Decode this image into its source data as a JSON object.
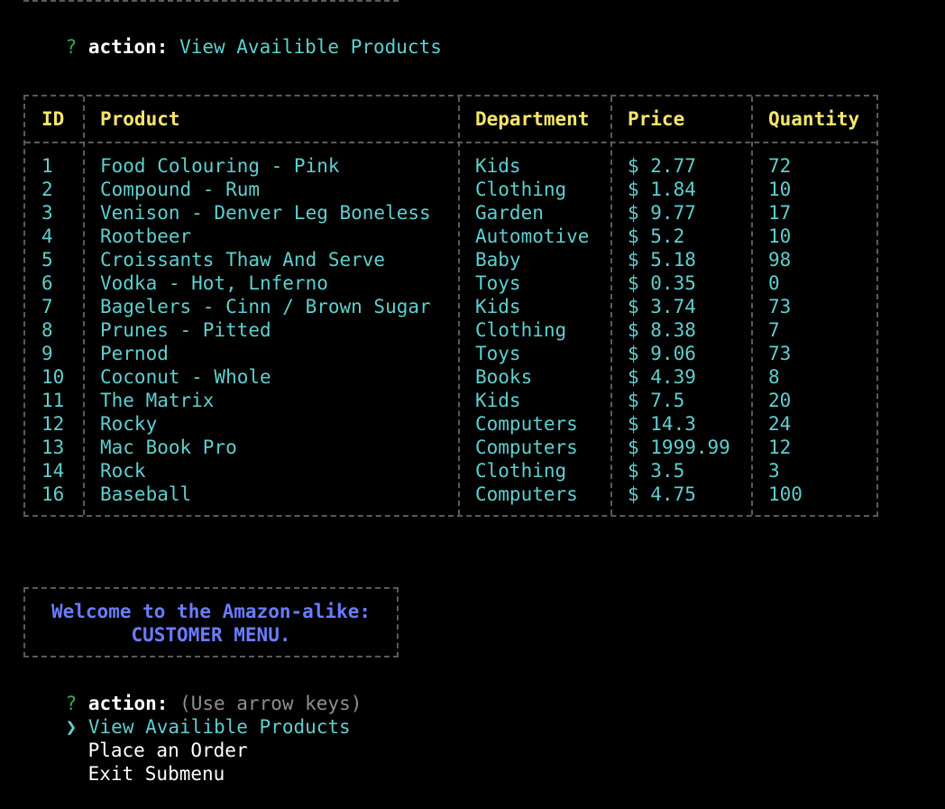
{
  "prompt_prefix": "?",
  "action_label": "action:",
  "previous_answer": "View Availible Products",
  "table": {
    "headers": [
      "ID",
      "Product",
      "Department",
      "Price",
      "Quantity"
    ],
    "rows": [
      [
        "1",
        "Food Colouring - Pink",
        "Kids",
        "$ 2.77",
        "72"
      ],
      [
        "2",
        "Compound - Rum",
        "Clothing",
        "$ 1.84",
        "10"
      ],
      [
        "3",
        "Venison - Denver Leg Boneless",
        "Garden",
        "$ 9.77",
        "17"
      ],
      [
        "4",
        "Rootbeer",
        "Automotive",
        "$ 5.2",
        "10"
      ],
      [
        "5",
        "Croissants Thaw And Serve",
        "Baby",
        "$ 5.18",
        "98"
      ],
      [
        "6",
        "Vodka - Hot, Lnferno",
        "Toys",
        "$ 0.35",
        "0"
      ],
      [
        "7",
        "Bagelers - Cinn / Brown Sugar",
        "Kids",
        "$ 3.74",
        "73"
      ],
      [
        "8",
        "Prunes - Pitted",
        "Clothing",
        "$ 8.38",
        "7"
      ],
      [
        "9",
        "Pernod",
        "Toys",
        "$ 9.06",
        "73"
      ],
      [
        "10",
        "Coconut - Whole",
        "Books",
        "$ 4.39",
        "8"
      ],
      [
        "11",
        "The Matrix",
        "Kids",
        "$ 7.5",
        "20"
      ],
      [
        "12",
        "Rocky",
        "Computers",
        "$ 14.3",
        "24"
      ],
      [
        "13",
        "Mac Book Pro",
        "Computers",
        "$ 1999.99",
        "12"
      ],
      [
        "14",
        "Rock",
        "Clothing",
        "$ 3.5",
        "3"
      ],
      [
        "16",
        "Baseball",
        "Computers",
        "$ 4.75",
        "100"
      ]
    ]
  },
  "menu_box": {
    "line1": "Welcome to the Amazon-alike:",
    "line2": "CUSTOMER MENU."
  },
  "current_prompt": {
    "hint": "(Use arrow keys)",
    "pointer": "❯",
    "options": [
      "View Availible Products",
      "Place an Order",
      "Exit Submenu"
    ]
  },
  "colors": {
    "background": "#000000",
    "cyan": "#5fcfcf",
    "yellow_header": "#f5e66b",
    "menu_blue": "#6b7cff",
    "prompt_green": "#34a853"
  }
}
